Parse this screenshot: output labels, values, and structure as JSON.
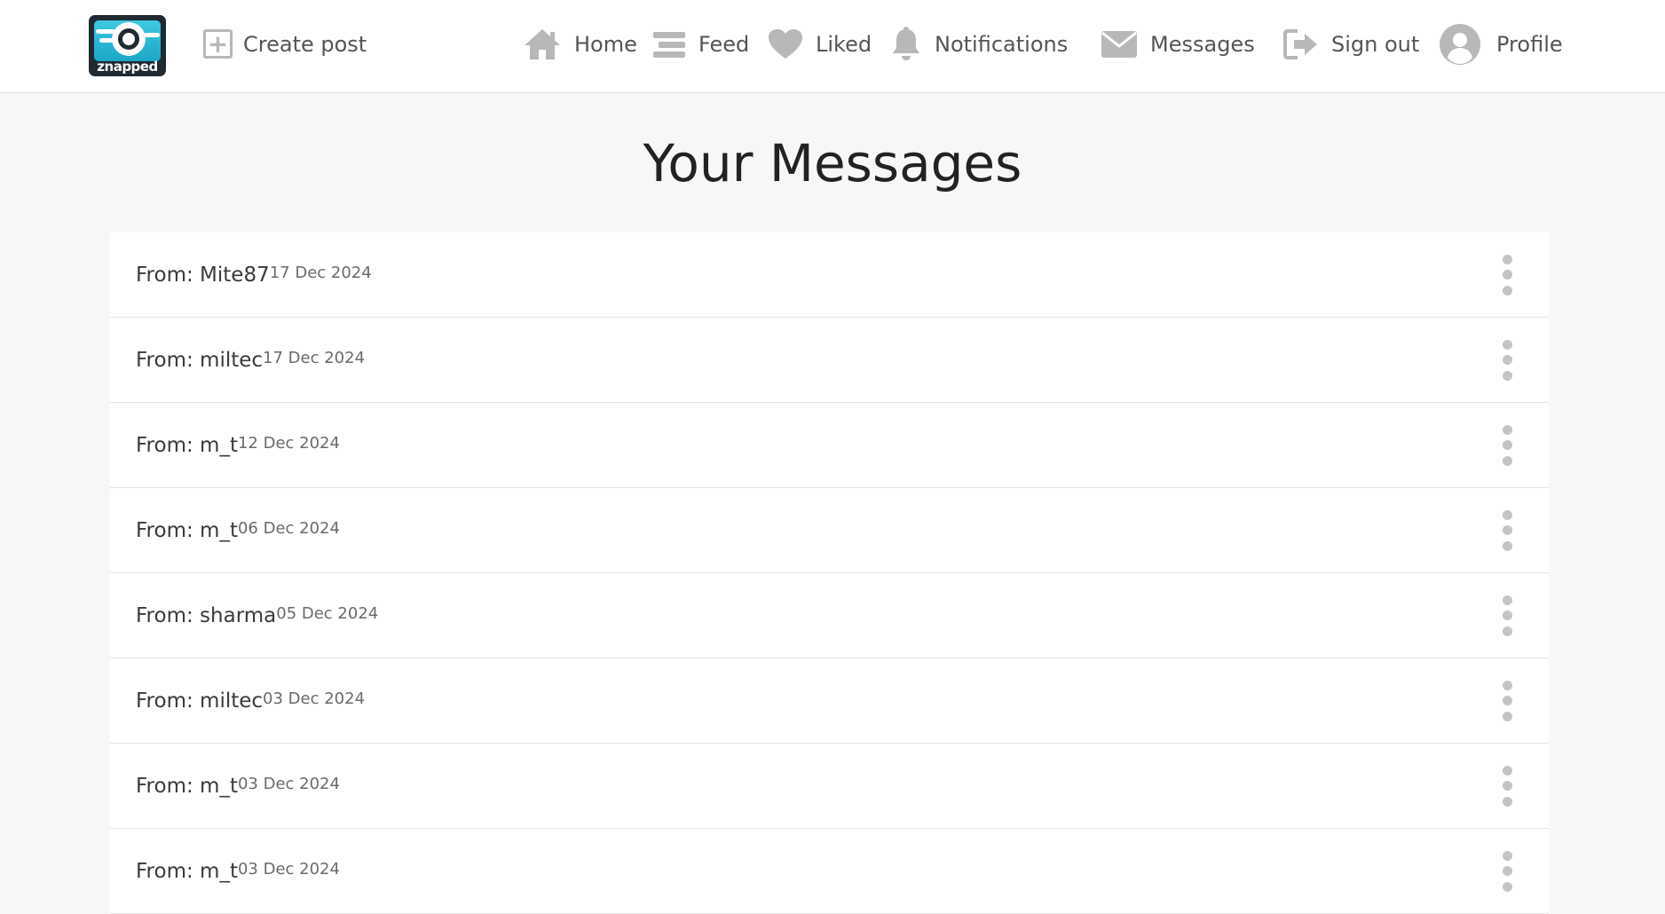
{
  "header": {
    "logo_text": "znapped",
    "create_post_label": "Create post",
    "nav": [
      {
        "id": "home",
        "label": "Home",
        "icon": "home-icon"
      },
      {
        "id": "feed",
        "label": "Feed",
        "icon": "feed-icon"
      },
      {
        "id": "liked",
        "label": "Liked",
        "icon": "heart-icon"
      },
      {
        "id": "notifications",
        "label": "Notifications",
        "icon": "bell-icon"
      },
      {
        "id": "messages",
        "label": "Messages",
        "icon": "envelope-icon"
      },
      {
        "id": "signout",
        "label": "Sign out",
        "icon": "sign-out-icon"
      },
      {
        "id": "profile",
        "label": "Profile",
        "icon": "avatar-icon"
      }
    ]
  },
  "main": {
    "title": "Your Messages",
    "messages": [
      {
        "from": "From: Mite87",
        "date": "17 Dec 2024"
      },
      {
        "from": "From: miltec",
        "date": "17 Dec 2024"
      },
      {
        "from": "From: m_t",
        "date": "12 Dec 2024"
      },
      {
        "from": "From: m_t",
        "date": "06 Dec 2024"
      },
      {
        "from": "From: sharma",
        "date": "05 Dec 2024"
      },
      {
        "from": "From: miltec",
        "date": "03 Dec 2024"
      },
      {
        "from": "From: m_t",
        "date": "03 Dec 2024"
      },
      {
        "from": "From: m_t",
        "date": "03 Dec 2024"
      }
    ]
  },
  "colors": {
    "icon_gray": "#b8b8b8",
    "logo_cyan": "#1aa7c8",
    "logo_dark": "#1f2a33"
  }
}
